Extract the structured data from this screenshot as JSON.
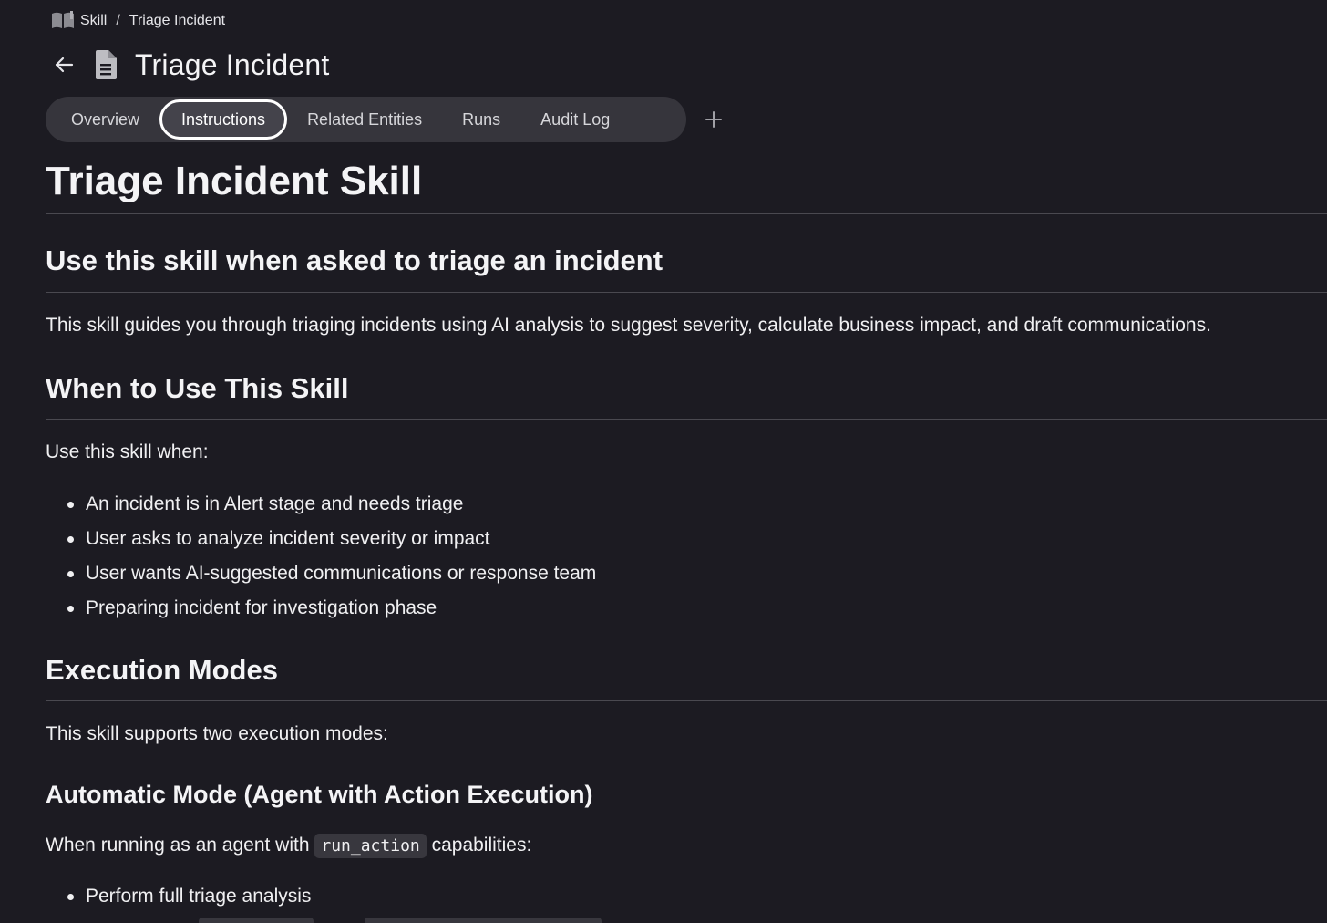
{
  "breadcrumb": {
    "icon": "book-icon",
    "items": [
      "Skill",
      "Triage Incident"
    ],
    "separator": "/"
  },
  "header": {
    "back_icon": "arrow-left-icon",
    "doc_icon": "document-icon",
    "title": "Triage Incident"
  },
  "tabs": {
    "items": [
      {
        "label": "Overview",
        "active": false
      },
      {
        "label": "Instructions",
        "active": true
      },
      {
        "label": "Related Entities",
        "active": false
      },
      {
        "label": "Runs",
        "active": false
      },
      {
        "label": "Audit Log",
        "active": false
      }
    ],
    "add_icon": "plus-icon"
  },
  "doc": {
    "h1": "Triage Incident Skill",
    "section1": {
      "heading": "Use this skill when asked to triage an incident",
      "body": "This skill guides you through triaging incidents using AI analysis to suggest severity, calculate business impact, and draft communications."
    },
    "section2": {
      "heading": "When to Use This Skill",
      "intro": "Use this skill when:",
      "items": [
        "An incident is in Alert stage and needs triage",
        "User asks to analyze incident severity or impact",
        "User wants AI-suggested communications or response team",
        "Preparing incident for investigation phase"
      ]
    },
    "section3": {
      "heading": "Execution Modes",
      "intro": "This skill supports two execution modes:",
      "sub": {
        "heading": "Automatic Mode (Agent with Action Execution)",
        "body_before": "When running as an agent with",
        "code": "run_action",
        "body_after": "capabilities:",
        "items": [
          "Perform full triage analysis"
        ]
      }
    }
  },
  "colors": {
    "background": "#1c1b22",
    "tab_bar": "#36353c",
    "active_tab_border": "#ffffff",
    "text": "#f2f2f4",
    "rule": "#4a4950"
  }
}
